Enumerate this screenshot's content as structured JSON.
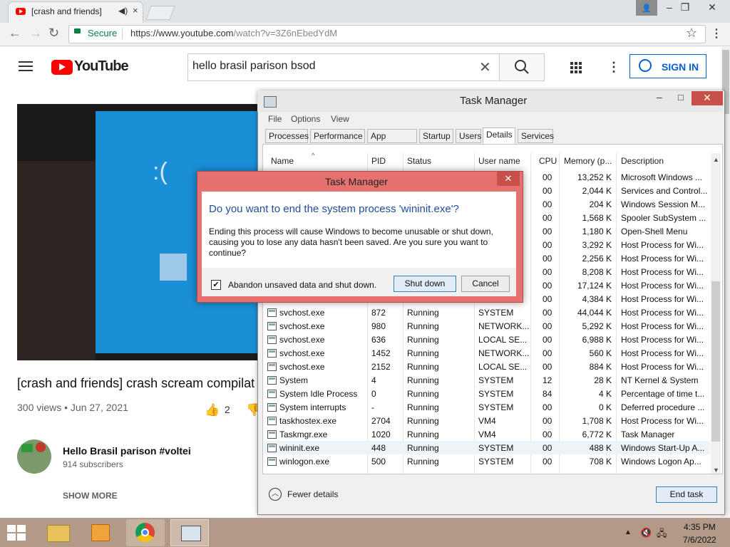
{
  "browser": {
    "tab_title": "[crash and friends] cra",
    "tab_audio_icon": "speaker-icon",
    "tab_close": "×",
    "secure_label": "Secure",
    "url_host": "https://www.youtube.com",
    "url_path": "/watch?v=3Z6nEbedYdM",
    "back": "←",
    "forward": "→",
    "reload": "↻",
    "star": "☆",
    "menu": "⋮",
    "window_user": "👤",
    "window_min": "–",
    "window_restore": "❐",
    "window_close": "✕"
  },
  "youtube": {
    "logo_text": "YouTube",
    "search_value": "hello brasil parison bsod",
    "search_clear": "✕",
    "search_icon": "⌕",
    "more_icon": "⋮",
    "sign_in": "SIGN IN",
    "video_face": ":(",
    "video_title": "[crash and friends] crash scream compilat",
    "video_meta": "300 views • Jun 27, 2021",
    "like_icon": "👍",
    "like_count": "2",
    "dislike_icon": "👎",
    "channel_name": "Hello Brasil parison #voltei",
    "channel_subs": "914 subscribers",
    "show_more": "SHOW MORE"
  },
  "task_manager": {
    "title": "Task Manager",
    "min": "–",
    "max": "□",
    "close": "✕",
    "menu": [
      "File",
      "Options",
      "View"
    ],
    "tabs": [
      "Processes",
      "Performance",
      "App history",
      "Startup",
      "Users",
      "Details",
      "Services"
    ],
    "active_tab": "Details",
    "columns": [
      "Name",
      "PID",
      "Status",
      "User name",
      "CPU",
      "Memory (p...",
      "Description"
    ],
    "top_rows": [
      {
        "cpu": "00",
        "memory": "13,252 K",
        "desc": "Microsoft Windows ..."
      },
      {
        "cpu": "00",
        "memory": "2,044 K",
        "desc": "Services and Control..."
      },
      {
        "cpu": "00",
        "memory": "204 K",
        "desc": "Windows Session M..."
      },
      {
        "cpu": "00",
        "memory": "1,568 K",
        "desc": "Spooler SubSystem ..."
      },
      {
        "cpu": "00",
        "memory": "1,180 K",
        "desc": "Open-Shell Menu"
      },
      {
        "cpu": "00",
        "memory": "3,292 K",
        "desc": "Host Process for Wi..."
      },
      {
        "cpu": "00",
        "memory": "2,256 K",
        "desc": "Host Process for Wi..."
      },
      {
        "cpu": "00",
        "memory": "8,208 K",
        "desc": "Host Process for Wi..."
      },
      {
        "cpu": "00",
        "memory": "17,124 K",
        "desc": "Host Process for Wi..."
      },
      {
        "cpu": "00",
        "memory": "4,384 K",
        "desc": "Host Process for Wi..."
      }
    ],
    "rows": [
      {
        "name": "svchost.exe",
        "pid": "872",
        "status": "Running",
        "user": "SYSTEM",
        "cpu": "00",
        "memory": "44,044 K",
        "desc": "Host Process for Wi..."
      },
      {
        "name": "svchost.exe",
        "pid": "980",
        "status": "Running",
        "user": "NETWORK...",
        "cpu": "00",
        "memory": "5,292 K",
        "desc": "Host Process for Wi..."
      },
      {
        "name": "svchost.exe",
        "pid": "636",
        "status": "Running",
        "user": "LOCAL SE...",
        "cpu": "00",
        "memory": "6,988 K",
        "desc": "Host Process for Wi..."
      },
      {
        "name": "svchost.exe",
        "pid": "1452",
        "status": "Running",
        "user": "NETWORK...",
        "cpu": "00",
        "memory": "560 K",
        "desc": "Host Process for Wi..."
      },
      {
        "name": "svchost.exe",
        "pid": "2152",
        "status": "Running",
        "user": "LOCAL SE...",
        "cpu": "00",
        "memory": "884 K",
        "desc": "Host Process for Wi..."
      },
      {
        "name": "System",
        "pid": "4",
        "status": "Running",
        "user": "SYSTEM",
        "cpu": "12",
        "memory": "28 K",
        "desc": "NT Kernel & System"
      },
      {
        "name": "System Idle Process",
        "pid": "0",
        "status": "Running",
        "user": "SYSTEM",
        "cpu": "84",
        "memory": "4 K",
        "desc": "Percentage of time t..."
      },
      {
        "name": "System interrupts",
        "pid": "-",
        "status": "Running",
        "user": "SYSTEM",
        "cpu": "00",
        "memory": "0 K",
        "desc": "Deferred procedure ..."
      },
      {
        "name": "taskhostex.exe",
        "pid": "2704",
        "status": "Running",
        "user": "VM4",
        "cpu": "00",
        "memory": "1,708 K",
        "desc": "Host Process for Wi..."
      },
      {
        "name": "Taskmgr.exe",
        "pid": "1020",
        "status": "Running",
        "user": "VM4",
        "cpu": "00",
        "memory": "6,772 K",
        "desc": "Task Manager"
      },
      {
        "name": "wininit.exe",
        "pid": "448",
        "status": "Running",
        "user": "SYSTEM",
        "cpu": "00",
        "memory": "488 K",
        "desc": "Windows Start-Up A..."
      },
      {
        "name": "winlogon.exe",
        "pid": "500",
        "status": "Running",
        "user": "SYSTEM",
        "cpu": "00",
        "memory": "708 K",
        "desc": "Windows Logon Ap..."
      }
    ],
    "fewer_details": "Fewer details",
    "fewer_icon": "︿",
    "end_task": "End task"
  },
  "dialog": {
    "title": "Task Manager",
    "close": "✕",
    "question": "Do you want to end the system process 'wininit.exe'?",
    "message": "Ending this process will cause Windows to become unusable or shut down, causing you to lose any data hasn't been saved. Are you sure you want to continue?",
    "checkbox_label": "Abandon unsaved data and shut down.",
    "checkbox_mark": "✔",
    "checked": true,
    "shut_down": "Shut down",
    "cancel": "Cancel"
  },
  "taskbar": {
    "tray_up": "▲",
    "tray_volume": "🔇",
    "tray_network": "🖧",
    "time": "4:35 PM",
    "date": "7/6/2022"
  }
}
